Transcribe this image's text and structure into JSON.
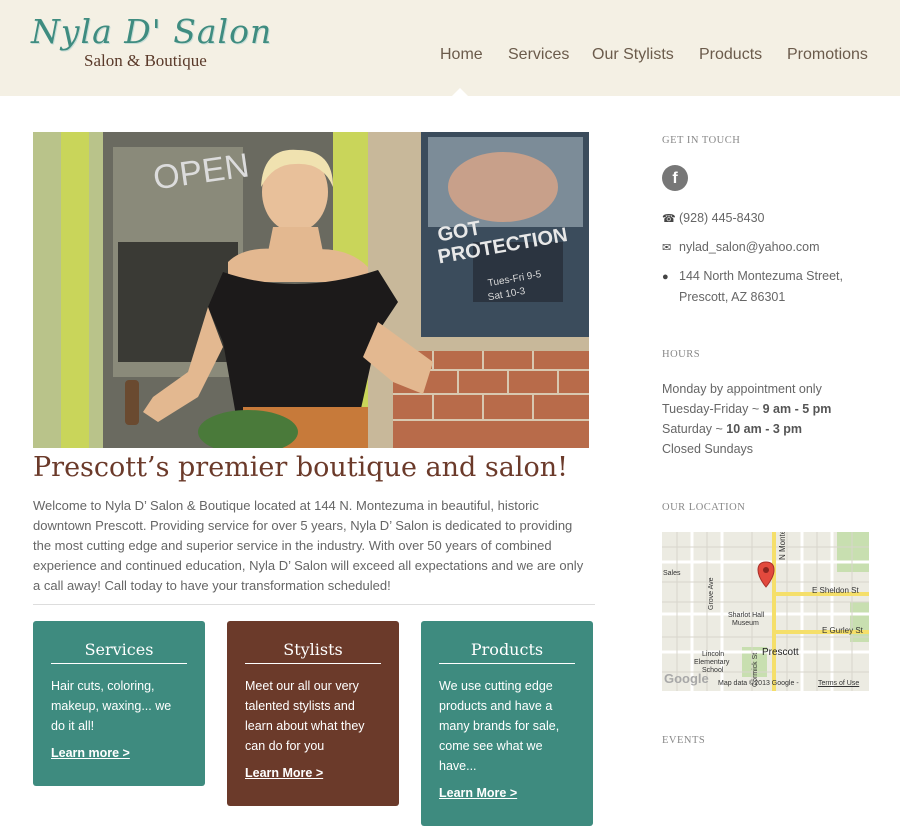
{
  "header": {
    "logo_script": "Nyla D' Salon",
    "logo_sub": "Salon & Boutique",
    "nav": [
      "Home",
      "Services",
      "Our Stylists",
      "Products",
      "Promotions"
    ]
  },
  "main": {
    "headline": "Prescott’s premier boutique and salon!",
    "intro": "Welcome to Nyla D’ Salon & Boutique located at 144 N. Montezuma in beautiful, historic downtown Prescott. Providing service for over 5 years, Nyla D’ Salon is dedicated to providing the most cutting edge and superior service in the industry. With over 50 years of combined experience and continued education, Nyla D’ Salon will exceed all expectations and we are only a call away! Call today to have your transformation scheduled!",
    "hero_signs": {
      "open": "OPEN",
      "poster_line1": "GOT",
      "poster_line2": "PROTECTION",
      "hours_sign_1": "Tues-Fri 9-5",
      "hours_sign_2": "Sat 10-3"
    },
    "boxes": [
      {
        "title": "Services",
        "text": "Hair cuts, coloring, makeup, waxing... we do it all!",
        "link": "Learn more >",
        "color": "#3e8b7f"
      },
      {
        "title": "Stylists",
        "text": "Meet our all our very talented stylists and learn about what they can do for you",
        "link": "Learn More >",
        "color": "#6b3a2a"
      },
      {
        "title": "Products",
        "text": "We use cutting edge products and have a many brands for sale, come see what we have...",
        "link": "Learn More >",
        "color": "#3e8b7f"
      }
    ]
  },
  "sidebar": {
    "get_in_touch": "GET IN TOUCH",
    "facebook_glyph": "f",
    "phone": "(928) 445-8430",
    "email": "nylad_salon@yahoo.com",
    "address_1": "144 North Montezuma Street,",
    "address_2": "Prescott, AZ 86301",
    "hours_heading": "HOURS",
    "hours": {
      "monday": "Monday by appointment only",
      "tuefri_label": "Tuesday-Friday ~ ",
      "tuefri_time": "9 am - 5 pm",
      "sat_label": "Saturday ~ ",
      "sat_time": "10 am - 3 pm",
      "sunday": "Closed Sundays"
    },
    "location_heading": "OUR LOCATION",
    "map": {
      "streets": {
        "n_montezuma": "N Montezuma",
        "e_sheldon": "E Sheldon St",
        "e_gurley": "E Gurley St",
        "grove": "Grove Ave",
        "cormick": "Cormick St"
      },
      "places": {
        "sales": "Sales",
        "sharlot_1": "Sharlot Hall",
        "sharlot_2": "Museum",
        "lincoln_1": "Lincoln",
        "lincoln_2": "Elementary",
        "lincoln_3": "School",
        "prescott": "Prescott"
      },
      "google": "Google",
      "map_data": "Map data ©2013 Google -",
      "terms": "Terms of Use"
    },
    "events_heading": "EVENTS"
  },
  "colors": {
    "teal": "#3e8b7f",
    "brown": "#6b3a2a",
    "header_bg": "#f4f0e4"
  },
  "icons": {
    "phone": "phone-icon",
    "email": "envelope-icon",
    "address": "map-pin-icon",
    "facebook": "facebook-icon"
  }
}
